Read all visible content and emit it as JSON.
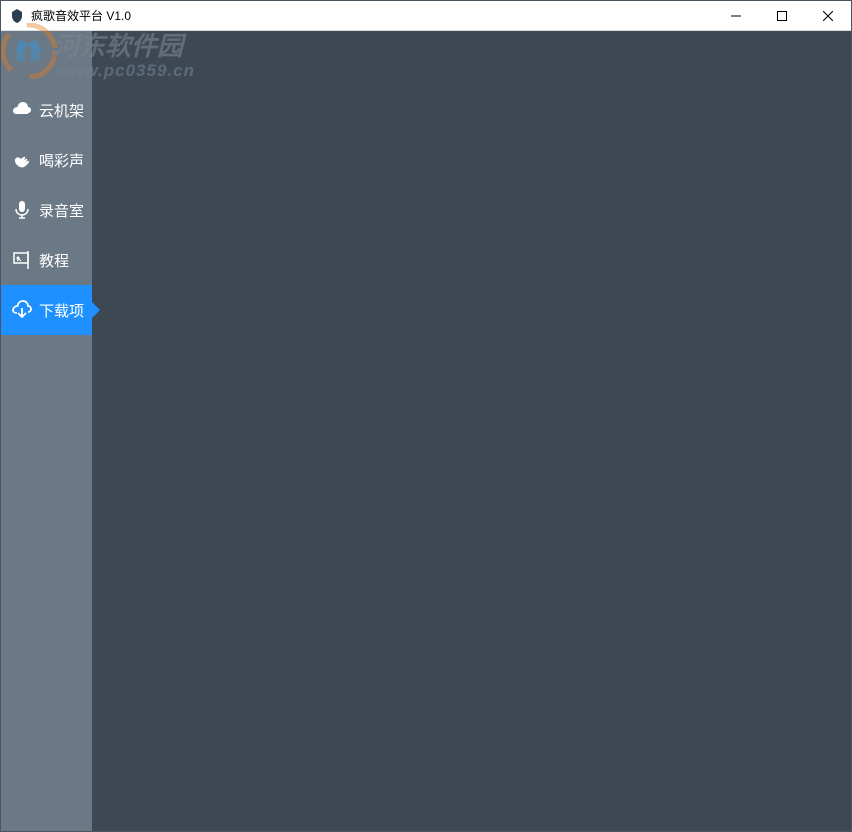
{
  "window": {
    "title": "疯歌音效平台 V1.0"
  },
  "watermark": {
    "text": "河东软件园",
    "url": "www.pc0359.cn"
  },
  "sidebar": {
    "items": [
      {
        "label": "云机架",
        "icon": "cloud",
        "active": false
      },
      {
        "label": "喝彩声",
        "icon": "applause",
        "active": false
      },
      {
        "label": "录音室",
        "icon": "microphone",
        "active": false
      },
      {
        "label": "教程",
        "icon": "tutorial",
        "active": false
      },
      {
        "label": "下载项",
        "icon": "download",
        "active": true
      }
    ]
  }
}
